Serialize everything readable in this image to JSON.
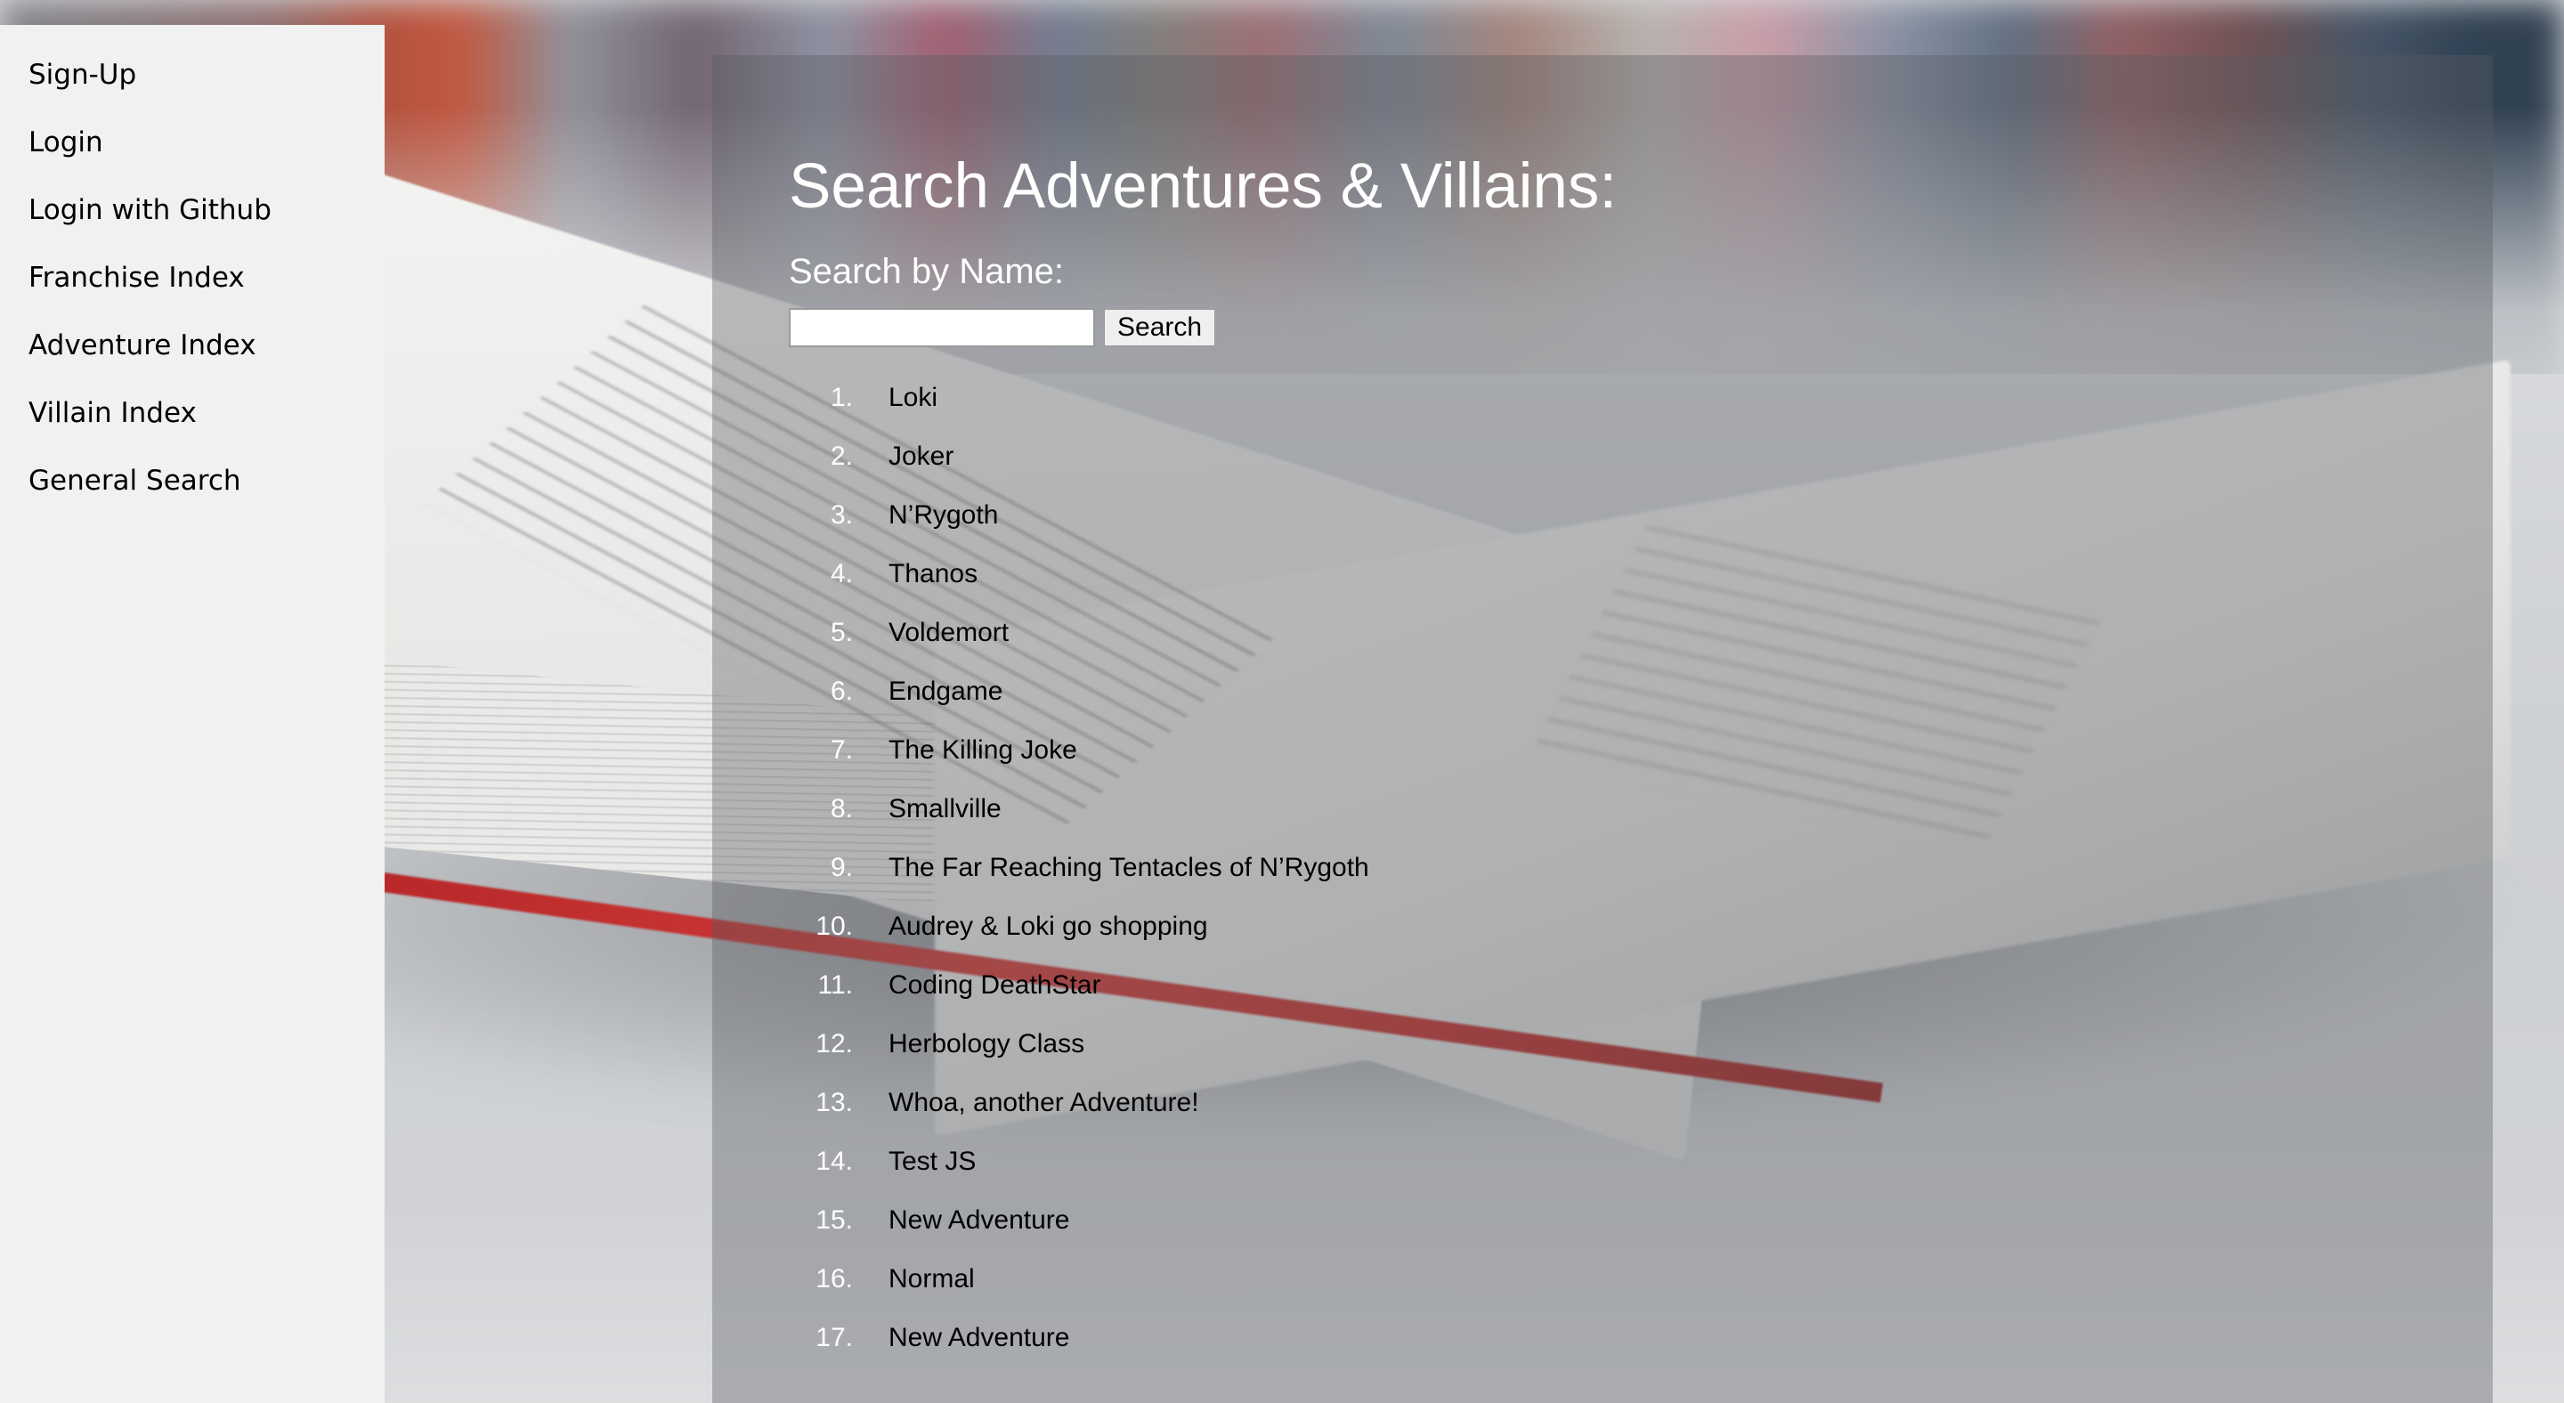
{
  "sidebar": {
    "items": [
      {
        "label": "Sign-Up"
      },
      {
        "label": "Login"
      },
      {
        "label": "Login with Github"
      },
      {
        "label": "Franchise Index"
      },
      {
        "label": "Adventure Index"
      },
      {
        "label": "Villain Index"
      },
      {
        "label": "General Search"
      }
    ]
  },
  "main": {
    "title": "Search Adventures & Villains:",
    "search_label": "Search by Name:",
    "search_input_value": "",
    "search_button_label": "Search",
    "results": [
      {
        "num": "1.",
        "name": "Loki"
      },
      {
        "num": "2.",
        "name": "Joker"
      },
      {
        "num": "3.",
        "name": "N’Rygoth"
      },
      {
        "num": "4.",
        "name": "Thanos"
      },
      {
        "num": "5.",
        "name": "Voldemort"
      },
      {
        "num": "6.",
        "name": "Endgame"
      },
      {
        "num": "7.",
        "name": "The Killing Joke"
      },
      {
        "num": "8.",
        "name": "Smallville"
      },
      {
        "num": "9.",
        "name": "The Far Reaching Tentacles of N’Rygoth"
      },
      {
        "num": "10.",
        "name": "Audrey & Loki go shopping"
      },
      {
        "num": "11.",
        "name": "Coding DeathStar"
      },
      {
        "num": "12.",
        "name": "Herbology Class"
      },
      {
        "num": "13.",
        "name": "Whoa, another Adventure!"
      },
      {
        "num": "14.",
        "name": "Test JS"
      },
      {
        "num": "15.",
        "name": "New Adventure"
      },
      {
        "num": "16.",
        "name": "Normal"
      },
      {
        "num": "17.",
        "name": "New Adventure"
      }
    ]
  },
  "colors": {
    "sidebar_bg": "#f1f1f1",
    "panel_overlay": "rgba(90,92,96,0.38)",
    "title_text": "#ffffff",
    "accent_red": "#c23230"
  }
}
